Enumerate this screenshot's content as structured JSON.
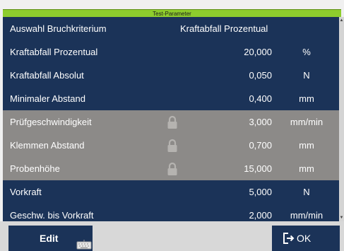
{
  "window": {
    "title": "Test-Parameter"
  },
  "colors": {
    "accent": "#8ecd2d",
    "row_navy": "#1b3358",
    "row_locked": "#8c8a88",
    "lock_icon": "#b5b3b0"
  },
  "rows": [
    {
      "label": "Auswahl Bruchkriterium",
      "value": "Kraftabfall Prozentual",
      "unit": "",
      "locked": false
    },
    {
      "label": "Kraftabfall Prozentual",
      "value": "20,000",
      "unit": "%",
      "locked": false
    },
    {
      "label": "Kraftabfall Absolut",
      "value": "0,050",
      "unit": "N",
      "locked": false
    },
    {
      "label": "Minimaler Abstand",
      "value": "0,400",
      "unit": "mm",
      "locked": false
    },
    {
      "label": "Prüfgeschwindigkeit",
      "value": "3,000",
      "unit": "mm/min",
      "locked": true,
      "icon": "lock-icon"
    },
    {
      "label": "Klemmen Abstand",
      "value": "0,700",
      "unit": "mm",
      "locked": true,
      "icon": "lock-icon"
    },
    {
      "label": "Probenhöhe",
      "value": "15,000",
      "unit": "mm",
      "locked": true,
      "icon": "lock-icon"
    },
    {
      "label": "Vorkraft",
      "value": "5,000",
      "unit": "N",
      "locked": false
    },
    {
      "label": "Geschw. bis Vorkraft",
      "value": "2,000",
      "unit": "mm/min",
      "locked": false
    }
  ],
  "footer": {
    "edit_label": "Edit",
    "edit_icon": "keyboard-icon",
    "ok_label": "OK",
    "ok_icon": "exit-arrow-icon"
  },
  "scrollbar": {
    "up_icon": "chevron-up-icon",
    "down_icon": "chevron-down-icon"
  }
}
